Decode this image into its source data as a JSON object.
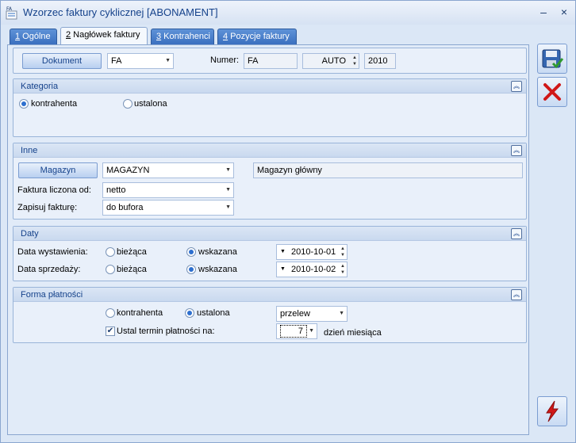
{
  "window": {
    "title": "Wzorzec faktury cyklicznej [ABONAMENT]",
    "app_icon_text": "FA",
    "minimize": "–",
    "close": "×"
  },
  "tabs": [
    {
      "key": "1",
      "label": " Ogólne"
    },
    {
      "key": "2",
      "label": " Nagłówek faktury"
    },
    {
      "key": "3",
      "label": " Kontrahenci"
    },
    {
      "key": "4",
      "label": " Pozycje faktury"
    }
  ],
  "header": {
    "document_button": "Dokument",
    "document_type": "FA",
    "numer_label": "Numer:",
    "numer_prefix": "FA",
    "numer_auto": "AUTO",
    "numer_year": "2010"
  },
  "kategoria": {
    "title": "Kategoria",
    "option1": "kontrahenta",
    "option2": "ustalona"
  },
  "inne": {
    "title": "Inne",
    "magazyn_button": "Magazyn",
    "magazyn_value": "MAGAZYN",
    "magazyn_name": "Magazyn główny",
    "liczona_label": "Faktura liczona od:",
    "liczona_value": "netto",
    "zapisuj_label": "Zapisuj fakturę:",
    "zapisuj_value": "do bufora"
  },
  "daty": {
    "title": "Daty",
    "wystawienia_label": "Data wystawienia:",
    "sprzedazy_label": "Data sprzedaży:",
    "biezaca": "bieżąca",
    "wskazana": "wskazana",
    "wystawienia_date": "2010-10-01",
    "sprzedazy_date": "2010-10-02"
  },
  "platnosci": {
    "title": "Forma płatności",
    "option1": "kontrahenta",
    "option2": "ustalona",
    "forma_value": "przelew",
    "ustal_label": "Ustal termin płatności na:",
    "ustal_value": "7",
    "dzien_label": "dzień miesiąca"
  },
  "colors": {
    "accent": "#15428b",
    "tab_inactive": "#3a6fbf",
    "save_icon": "#2c5aa0",
    "cancel_icon": "#d01818",
    "lightning_icon": "#d01818"
  }
}
